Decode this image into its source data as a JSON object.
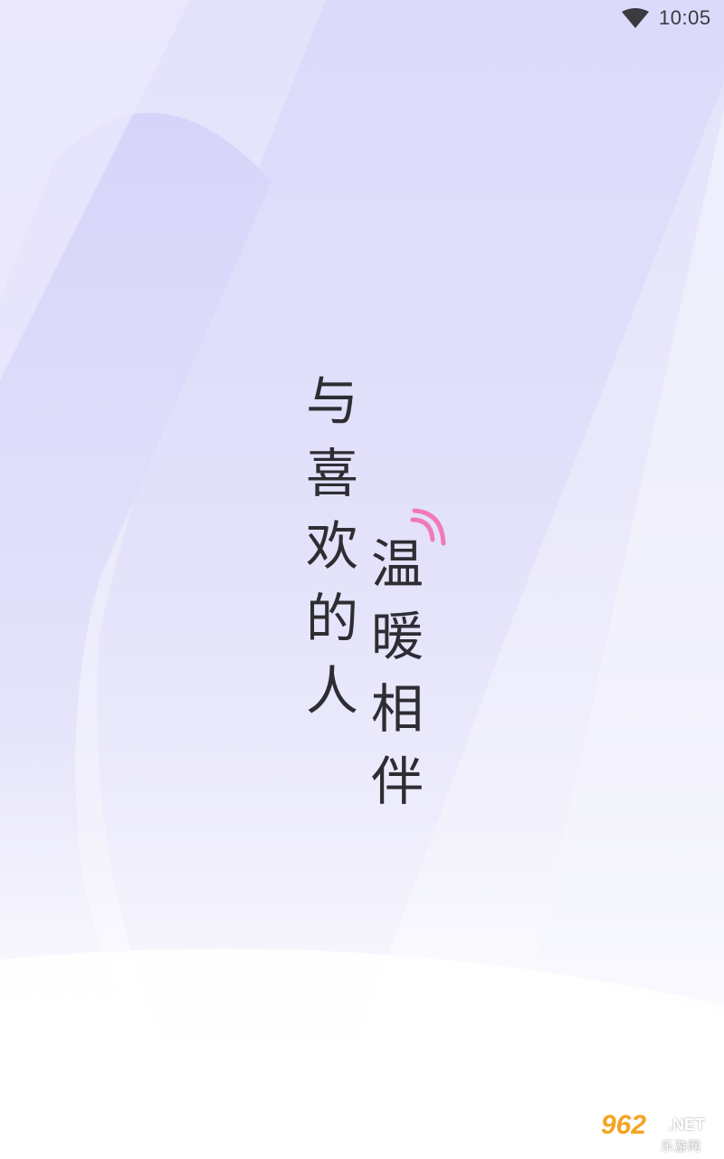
{
  "status_bar": {
    "time": "10:05",
    "wifi_icon": "wifi-icon"
  },
  "splash": {
    "slogan_line_1": "与喜欢的人",
    "slogan_line_2": "温暖相伴",
    "signal_icon": "signal-waves-icon",
    "signal_color": "#f07ab6",
    "text_color": "#2d2d33"
  },
  "watermark": {
    "brand": "962",
    "domain_suffix": ".NET",
    "site_name": "乐游网"
  }
}
